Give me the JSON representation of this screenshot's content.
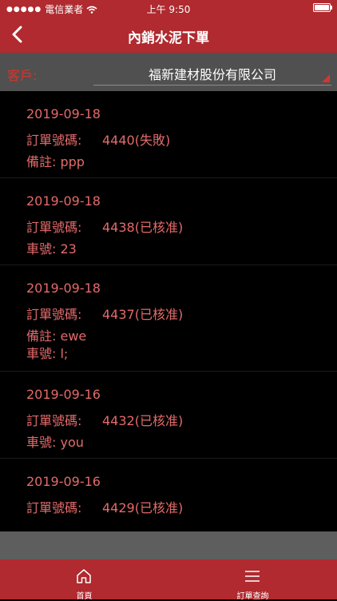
{
  "status_bar": {
    "carrier": "電信業者",
    "time": "上午 9:50"
  },
  "nav": {
    "title": "內銷水泥下單"
  },
  "customer": {
    "label": "客戶:",
    "value": "福新建材股份有限公司"
  },
  "orders": [
    {
      "date": "2019-09-18",
      "order_label": "訂單號碼:",
      "order_value": "4440(失敗)",
      "notes": [
        "備註: ppp"
      ]
    },
    {
      "date": "2019-09-18",
      "order_label": "訂單號碼:",
      "order_value": "4438(已核准)",
      "notes": [
        "車號: 23"
      ]
    },
    {
      "date": "2019-09-18",
      "order_label": "訂單號碼:",
      "order_value": "4437(已核准)",
      "notes": [
        "備註: ewe",
        "車號: l;"
      ]
    },
    {
      "date": "2019-09-16",
      "order_label": "訂單號碼:",
      "order_value": "4432(已核准)",
      "notes": [
        "車號: you"
      ]
    },
    {
      "date": "2019-09-16",
      "order_label": "訂單號碼:",
      "order_value": "4429(已核准)",
      "notes": []
    }
  ],
  "tabs": [
    {
      "label": "首頁",
      "icon": "home-icon"
    },
    {
      "label": "訂單查詢",
      "icon": "menu-icon"
    }
  ],
  "colors": {
    "brand_red": "#b02a2f",
    "text_red": "#e46a6a",
    "label_red": "#d5352f",
    "bar_gray": "#505050"
  }
}
